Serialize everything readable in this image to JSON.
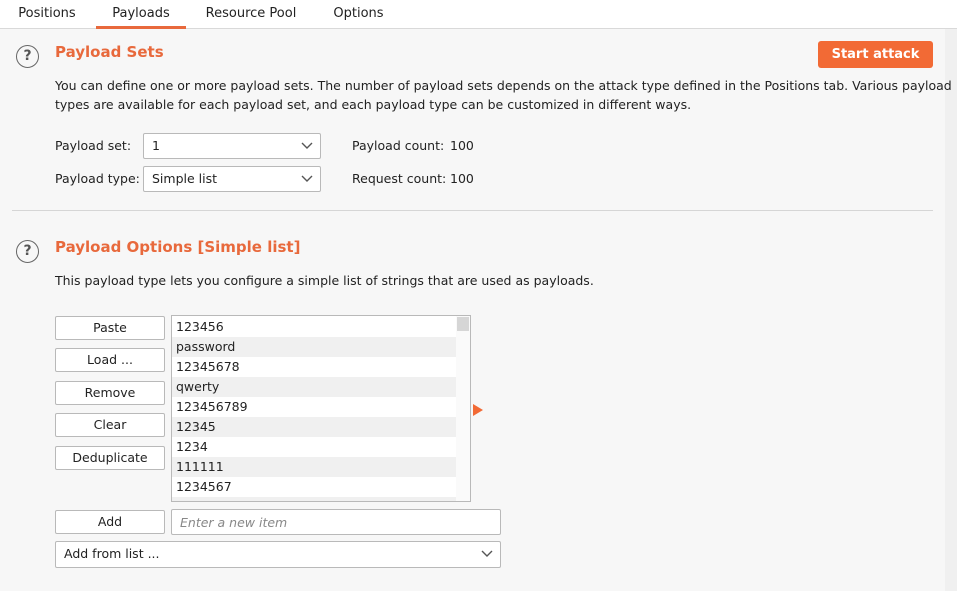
{
  "tabs": [
    {
      "label": "Positions"
    },
    {
      "label": "Payloads"
    },
    {
      "label": "Resource Pool"
    },
    {
      "label": "Options"
    }
  ],
  "active_tab": "Payloads",
  "payload_sets": {
    "help_glyph": "?",
    "title": "Payload Sets",
    "start_attack_label": "Start attack",
    "description_line1": "You can define one or more payload sets. The number of payload sets depends on the attack type defined in the Positions tab. Various payload",
    "description_line2": "types are available for each payload set, and each payload type can be customized in different ways.",
    "payload_set_label": "Payload set:",
    "payload_set_value": "1",
    "payload_type_label": "Payload type:",
    "payload_type_value": "Simple list",
    "payload_count_label": "Payload count:",
    "payload_count_value": "100",
    "request_count_label": "Request count:",
    "request_count_value": "100"
  },
  "payload_options": {
    "help_glyph": "?",
    "title": "Payload Options [Simple list]",
    "description": "This payload type lets you configure a simple list of strings that are used as payloads.",
    "buttons": {
      "paste": "Paste",
      "load": "Load ...",
      "remove": "Remove",
      "clear": "Clear",
      "deduplicate": "Deduplicate",
      "add": "Add"
    },
    "items": [
      "123456",
      "password",
      "12345678",
      "qwerty",
      "123456789",
      "12345",
      "1234",
      "111111",
      "1234567"
    ],
    "new_item_placeholder": "Enter a new item",
    "add_from_list_label": "Add from list ..."
  },
  "colors": {
    "accent": "#f26a35",
    "heading": "#e8693c"
  }
}
